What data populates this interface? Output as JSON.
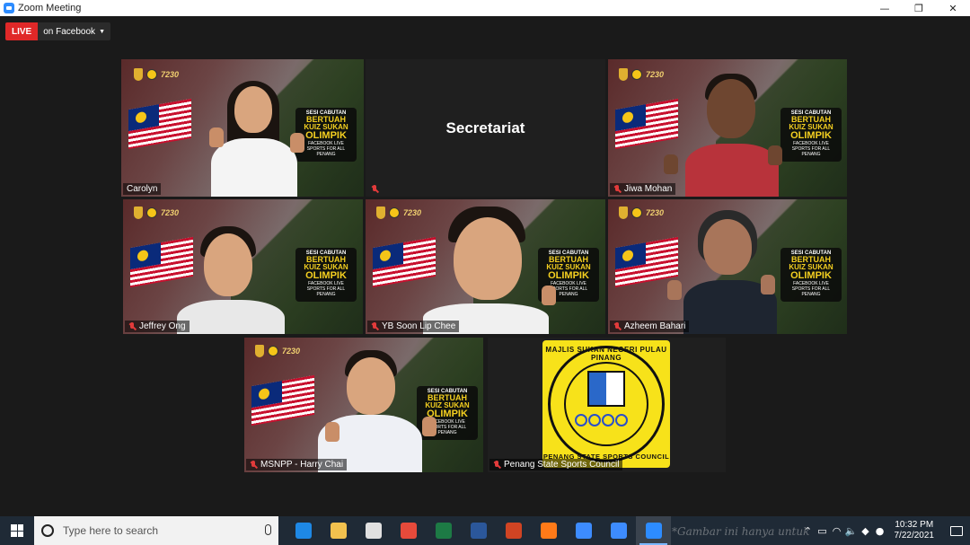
{
  "window": {
    "title": "Zoom Meeting",
    "minimize": "—",
    "maximize": "❐",
    "close": "✕"
  },
  "live": {
    "badge": "LIVE",
    "target": "on Facebook",
    "caret": "▼"
  },
  "poster": {
    "line1": "SESI CABUTAN",
    "line2": "BERTUAH",
    "line3": "KUIZ SUKAN",
    "line4": "OLIMPIK",
    "line5": "FACEBOOK LIVE",
    "line6": "SPORTS FOR ALL PENANG"
  },
  "participants": [
    {
      "name": "Carolyn",
      "muted": false,
      "active": true
    },
    {
      "name": "Secretariat",
      "muted": true,
      "video": false
    },
    {
      "name": "Jiwa Mohan",
      "muted": true
    },
    {
      "name": "Jeffrey Ong",
      "muted": true
    },
    {
      "name": "YB Soon Lip Chee",
      "muted": true
    },
    {
      "name": "Azheem Bahari",
      "muted": true
    },
    {
      "name": "MSNPP - Harry Chai",
      "muted": true
    },
    {
      "name": "Penang State Sports Council",
      "muted": true
    }
  ],
  "psc_logo": {
    "top_text": "MAJLIS SUKAN NEGERI PULAU PINANG",
    "bottom_text": "PENANG STATE SPORTS COUNCIL"
  },
  "taskbar": {
    "search_placeholder": "Type here to search",
    "apps": [
      {
        "icon": "edge-icon",
        "color": "#1e88e5"
      },
      {
        "icon": "file-explorer-icon",
        "color": "#f2c14e"
      },
      {
        "icon": "store-icon",
        "color": "#e0e0e0"
      },
      {
        "icon": "chrome-icon",
        "color": "#e64a3b"
      },
      {
        "icon": "excel-icon",
        "color": "#1d7a45"
      },
      {
        "icon": "word-icon",
        "color": "#2b579a"
      },
      {
        "icon": "powerpoint-icon",
        "color": "#d04423"
      },
      {
        "icon": "firefox-icon",
        "color": "#ff7a18"
      },
      {
        "icon": "app-icon",
        "color": "#3d8cff"
      },
      {
        "icon": "mail-icon",
        "color": "#3d8cff"
      },
      {
        "icon": "zoom-icon",
        "color": "#2d8cff"
      }
    ],
    "watermark": "*Gambar ini hanya untuk",
    "time": "10:32 PM",
    "date": "7/22/2021"
  }
}
